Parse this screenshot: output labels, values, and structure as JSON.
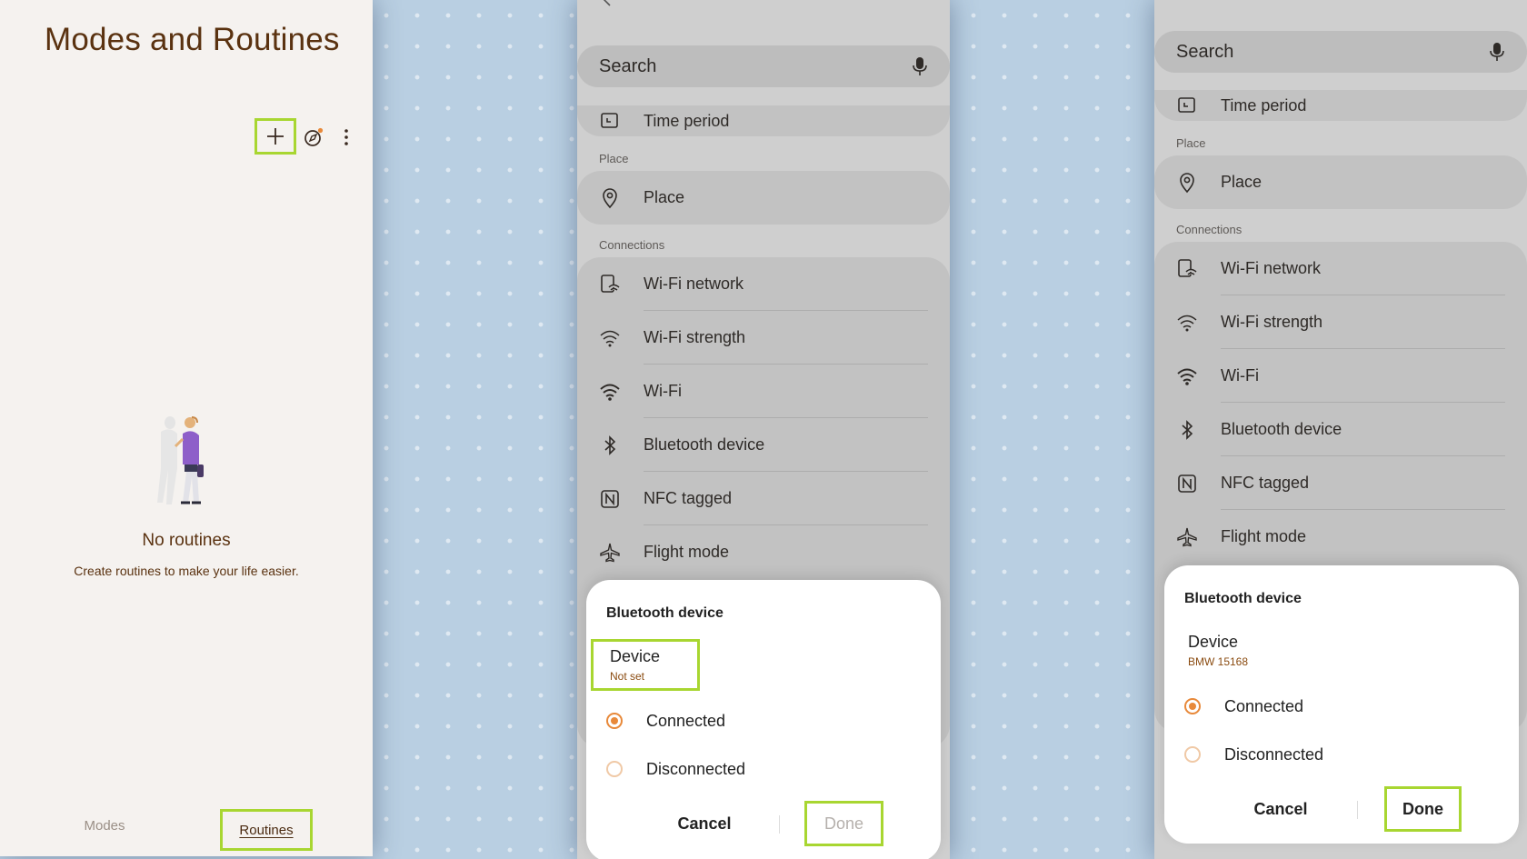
{
  "screen1": {
    "title": "Modes and Routines",
    "toolbar": {
      "add_icon": "plus-icon",
      "discover_icon": "compass-icon",
      "more_icon": "more-vertical-icon"
    },
    "empty_state": {
      "title": "No routines",
      "subtitle": "Create routines to make your life easier."
    },
    "bottom_nav": {
      "modes_label": "Modes",
      "routines_label": "Routines"
    }
  },
  "screen2": {
    "search_label": "Search",
    "sections": {
      "place_header": "Place",
      "connections_header": "Connections"
    },
    "items": {
      "time_period": "Time period",
      "place": "Place",
      "wifi_network": "Wi-Fi network",
      "wifi_strength": "Wi-Fi strength",
      "wifi": "Wi-Fi",
      "bluetooth_device": "Bluetooth device",
      "nfc_tagged": "NFC tagged",
      "flight_mode": "Flight mode"
    },
    "dialog": {
      "title": "Bluetooth device",
      "device_label": "Device",
      "device_value": "Not set",
      "options": [
        "Connected",
        "Disconnected"
      ],
      "selected_option": "Connected",
      "cancel_label": "Cancel",
      "done_label": "Done",
      "done_enabled": false
    }
  },
  "screen3": {
    "search_label": "Search",
    "sections": {
      "place_header": "Place",
      "connections_header": "Connections"
    },
    "items": {
      "time_period": "Time period",
      "place": "Place",
      "wifi_network": "Wi-Fi network",
      "wifi_strength": "Wi-Fi strength",
      "wifi": "Wi-Fi",
      "bluetooth_device": "Bluetooth device",
      "nfc_tagged": "NFC tagged",
      "flight_mode": "Flight mode"
    },
    "dialog": {
      "title": "Bluetooth device",
      "device_label": "Device",
      "device_value": "BMW 15168",
      "options": [
        "Connected",
        "Disconnected"
      ],
      "selected_option": "Connected",
      "cancel_label": "Cancel",
      "done_label": "Done",
      "done_enabled": true
    }
  },
  "colors": {
    "brand_text": "#5a3210",
    "accent_orange": "#e8893a",
    "highlight_green": "#a8d631",
    "wallpaper": "#b9cfe2"
  }
}
